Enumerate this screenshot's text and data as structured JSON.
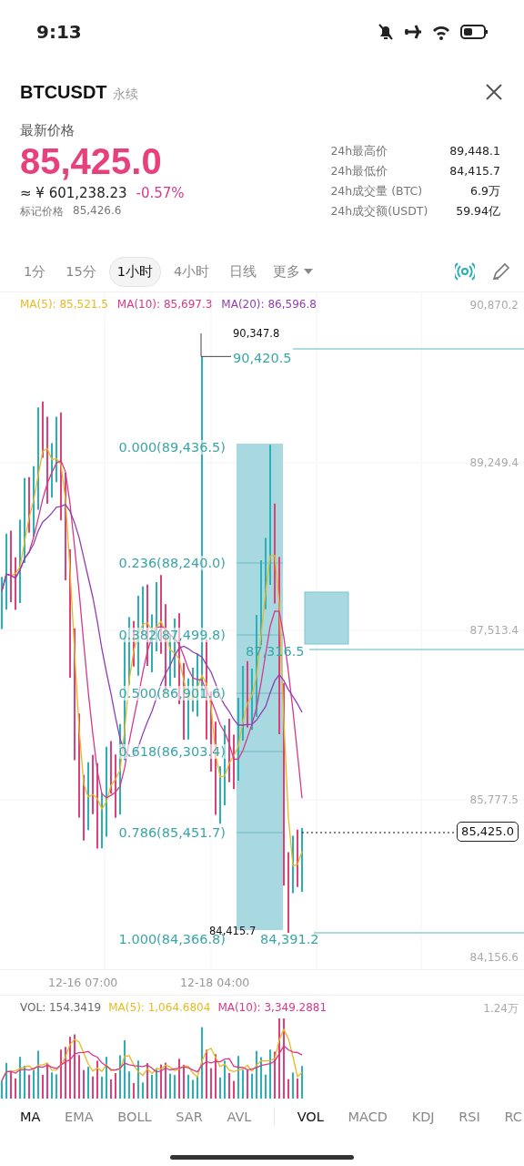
{
  "status_bar": {
    "time": "9:13"
  },
  "header": {
    "symbol": "BTCUSDT",
    "contract": "永续"
  },
  "price": {
    "label": "最新价格",
    "last": "85,425.0",
    "cny": "≈ ¥ 601,238.23",
    "change": "-0.57%",
    "mark_label": "标记价格",
    "mark_value": "85,426.6"
  },
  "stats": [
    {
      "label": "24h最高价",
      "value": "89,448.1"
    },
    {
      "label": "24h最低价",
      "value": "84,415.7"
    },
    {
      "label": "24h成交量 (BTC)",
      "value": "6.9万"
    },
    {
      "label": "24h成交额(USDT)",
      "value": "59.94亿"
    }
  ],
  "intervals": [
    {
      "label": "1分",
      "selected": false
    },
    {
      "label": "15分",
      "selected": false
    },
    {
      "label": "1小时",
      "selected": true
    },
    {
      "label": "4小时",
      "selected": false
    },
    {
      "label": "日线",
      "selected": false
    }
  ],
  "more": "更多",
  "chart": {
    "ma_legend": [
      {
        "label": "MA(5): 85,521.5",
        "color": "#e8b923"
      },
      {
        "label": "MA(10): 85,697.3",
        "color": "#d6398a"
      },
      {
        "label": "MA(20): 86,596.8",
        "color": "#8e3fb5"
      }
    ],
    "price_axis": [
      "90,870.2",
      "89,249.4",
      "87,513.4",
      "85,777.5",
      "84,156.6"
    ],
    "fib_levels": [
      "0.000(89,436.5)",
      "0.236(88,240.0)",
      "0.382(87,499.8)",
      "0.500(86,901.6)",
      "0.618(86,303.4)",
      "0.786(85,451.7)",
      "1.000(84,366.8)"
    ],
    "high_level": "90,420.5",
    "peak": "90,347.8",
    "mid_level": "87,316.5",
    "low": "84,415.7",
    "low_level": "84,391.2",
    "current": "85,425.0",
    "time_axis": [
      "12-16 07:00",
      "12-18 04:00"
    ]
  },
  "volume": {
    "legend": [
      {
        "label": "VOL: 154.3419",
        "color": "#666666"
      },
      {
        "label": "MA(5): 1,064.6804",
        "color": "#e8b923"
      },
      {
        "label": "MA(10): 3,349.2881",
        "color": "#d6398a"
      }
    ],
    "axis": "1.24万"
  },
  "main_indicators": [
    {
      "label": "MA",
      "selected": true
    },
    {
      "label": "EMA",
      "selected": false
    },
    {
      "label": "BOLL",
      "selected": false
    },
    {
      "label": "SAR",
      "selected": false
    },
    {
      "label": "AVL",
      "selected": false
    }
  ],
  "sub_indicators": [
    {
      "label": "VOL",
      "selected": true
    },
    {
      "label": "MACD",
      "selected": false
    },
    {
      "label": "KDJ",
      "selected": false
    },
    {
      "label": "RSI",
      "selected": false
    },
    {
      "label": "RC",
      "selected": false
    }
  ]
}
